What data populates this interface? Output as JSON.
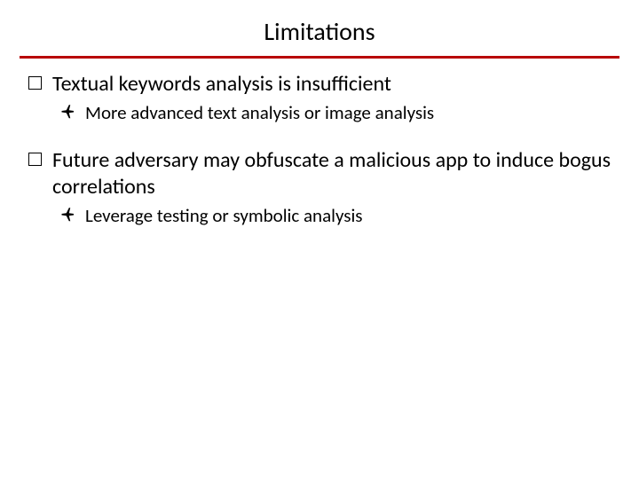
{
  "title": "Limitations",
  "colors": {
    "rule": "#b80000"
  },
  "bullets": [
    {
      "level": 1,
      "marker": "square",
      "text": "Textual keywords analysis is insufficient"
    },
    {
      "level": 2,
      "marker": "plane",
      "text": "More advanced text analysis or image analysis"
    },
    {
      "level": 1,
      "marker": "square",
      "text": "Future adversary may obfuscate a malicious app to induce bogus correlations"
    },
    {
      "level": 2,
      "marker": "plane",
      "text": "Leverage testing or symbolic analysis"
    }
  ]
}
